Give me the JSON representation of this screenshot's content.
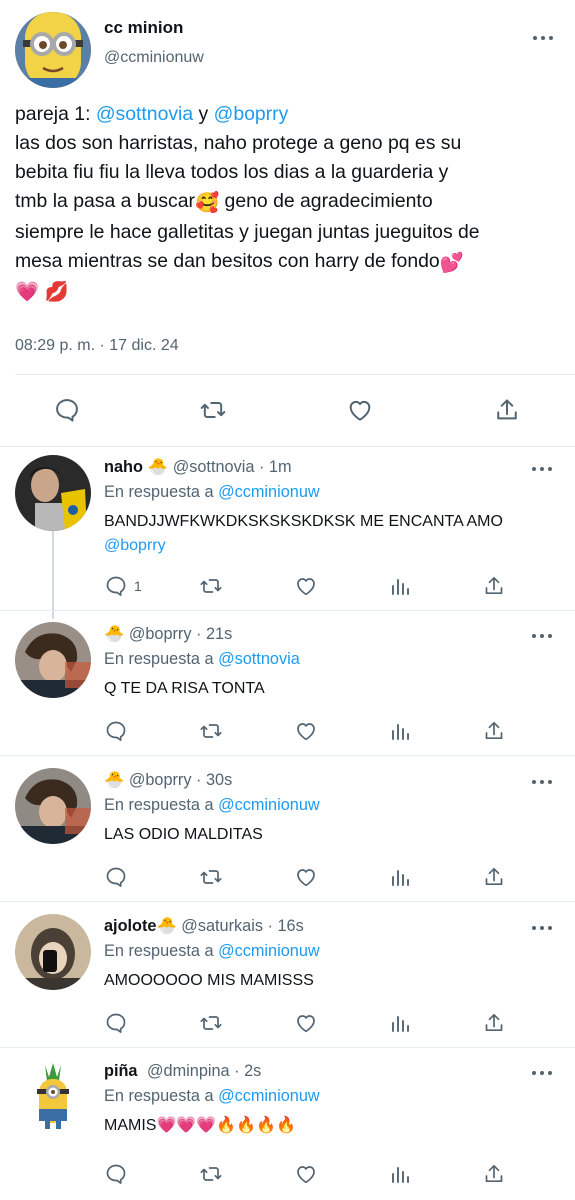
{
  "main_tweet": {
    "author_name": "cc minion",
    "author_handle": "@ccminionuw",
    "text_lines": [
      {
        "pre": "pareja 1: ",
        "mention1": "@sottnovia",
        "mid": " y ",
        "mention2": "@boprry"
      },
      {
        "text": "las dos son harristas, naho protege a geno pq es su"
      },
      {
        "text": "bebita fiu fiu la lleva todos los dias a la guarderia y"
      },
      {
        "text": "tmb la pasa a buscar",
        "emoji": "🥰",
        "rest": " geno de agradecimiento"
      },
      {
        "text": "siempre le hace galletitas y juegan juntas jueguitos de"
      },
      {
        "text": "mesa mientras se dan besitos con harry de fondo",
        "emoji": "💕"
      },
      {
        "emojis": "💗 💋"
      }
    ],
    "timestamp": "08:29 p. m. · 17 dic. 24",
    "actions": [
      "reply-icon",
      "retweet-icon",
      "like-icon",
      "share-icon"
    ]
  },
  "replies": [
    {
      "name": "naho",
      "badge": "🐣",
      "handle": "@sottnovia",
      "time": "· 1m",
      "in_reply_prefix": "En respuesta a",
      "in_reply_to": "@ccminionuw",
      "body_line1": "BANDJJWFKWKDKSKSKSKDKSK ME ENCANTA AMO",
      "body_mention": "@boprry",
      "reply_count": "1"
    },
    {
      "name": "",
      "badge": "🐣",
      "handle": "@boprry",
      "time": "· 21s",
      "in_reply_prefix": "En respuesta a",
      "in_reply_to": "@sottnovia",
      "body_line1": "Q TE DA RISA TONTA"
    },
    {
      "name": "",
      "badge": "🐣",
      "handle": "@boprry",
      "time": "· 30s",
      "in_reply_prefix": "En respuesta a",
      "in_reply_to": "@ccminionuw",
      "body_line1": "LAS ODIO MALDITAS"
    },
    {
      "name": "ajolote",
      "badge": "🐣",
      "handle": "@saturkais",
      "time": "· 16s",
      "in_reply_prefix": "En respuesta a",
      "in_reply_to": "@ccminionuw",
      "body_line1": "AMOOOOOO MIS MAMISSS"
    },
    {
      "name": "piña",
      "badge": "",
      "handle": "@dminpina",
      "time": "· 2s",
      "in_reply_prefix": "En respuesta a",
      "in_reply_to": "@ccminionuw",
      "body_line1": "MAMIS💗💗💗🔥🔥🔥🔥"
    }
  ],
  "colors": {
    "link": "#1d9bf0",
    "secondary_text": "#536471",
    "divider": "#e6ecf0",
    "thread_line": "#cfd9de"
  }
}
